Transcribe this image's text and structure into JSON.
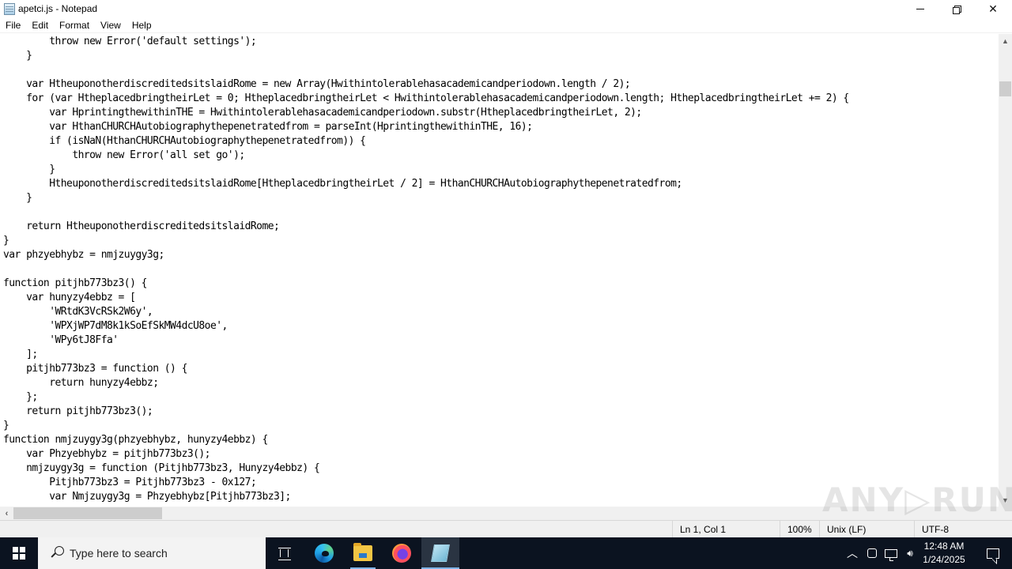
{
  "window": {
    "title": "apetci.js - Notepad",
    "controls": {
      "minimize": "minimize",
      "maximize": "restore",
      "close": "close"
    }
  },
  "menu": {
    "items": [
      {
        "label": "File"
      },
      {
        "label": "Edit"
      },
      {
        "label": "Format"
      },
      {
        "label": "View"
      },
      {
        "label": "Help"
      }
    ]
  },
  "editor": {
    "lines": [
      "        throw new Error('default settings');",
      "    }",
      "",
      "    var HtheuponotherdiscreditedsitslaidRome = new Array(Hwithintolerablehasacademicandperiodown.length / 2);",
      "    for (var HtheplacedbringtheirLet = 0; HtheplacedbringtheirLet < Hwithintolerablehasacademicandperiodown.length; HtheplacedbringtheirLet += 2) {",
      "        var HprintingthewithinTHE = Hwithintolerablehasacademicandperiodown.substr(HtheplacedbringtheirLet, 2);",
      "        var HthanCHURCHAutobiographythepenetratedfrom = parseInt(HprintingthewithinTHE, 16);",
      "        if (isNaN(HthanCHURCHAutobiographythepenetratedfrom)) {",
      "            throw new Error('all set go');",
      "        }",
      "        HtheuponotherdiscreditedsitslaidRome[HtheplacedbringtheirLet / 2] = HthanCHURCHAutobiographythepenetratedfrom;",
      "    }",
      "",
      "    return HtheuponotherdiscreditedsitslaidRome;",
      "}",
      "var phzyebhybz = nmjzuygy3g;",
      "",
      "function pitjhb773bz3() {",
      "    var hunyzy4ebbz = [",
      "        'WRtdK3VcRSk2W6y',",
      "        'WPXjWP7dM8k1kSoEfSkMW4dcU8oe',",
      "        'WPy6tJ8Ffa'",
      "    ];",
      "    pitjhb773bz3 = function () {",
      "        return hunyzy4ebbz;",
      "    };",
      "    return pitjhb773bz3();",
      "}",
      "function nmjzuygy3g(phzyebhybz, hunyzy4ebbz) {",
      "    var Phzyebhybz = pitjhb773bz3();",
      "    nmjzuygy3g = function (Pitjhb773bz3, Hunyzy4ebbz) {",
      "        Pitjhb773bz3 = Pitjhb773bz3 - 0x127;",
      "        var Nmjzuygy3g = Phzyebhybz[Pitjhb773bz3];"
    ]
  },
  "statusbar": {
    "position": "Ln 1, Col 1",
    "zoom": "100%",
    "line_ending": "Unix (LF)",
    "encoding": "UTF-8"
  },
  "watermark": "ANY▷RUN",
  "taskbar": {
    "search_placeholder": "Type here to search",
    "pinned": [
      "Task View",
      "Microsoft Edge",
      "File Explorer",
      "Firefox",
      "Notepad"
    ],
    "tray": {
      "chevron": "^",
      "volume": "🔊",
      "time": "12:48 AM",
      "date": "1/24/2025"
    }
  }
}
